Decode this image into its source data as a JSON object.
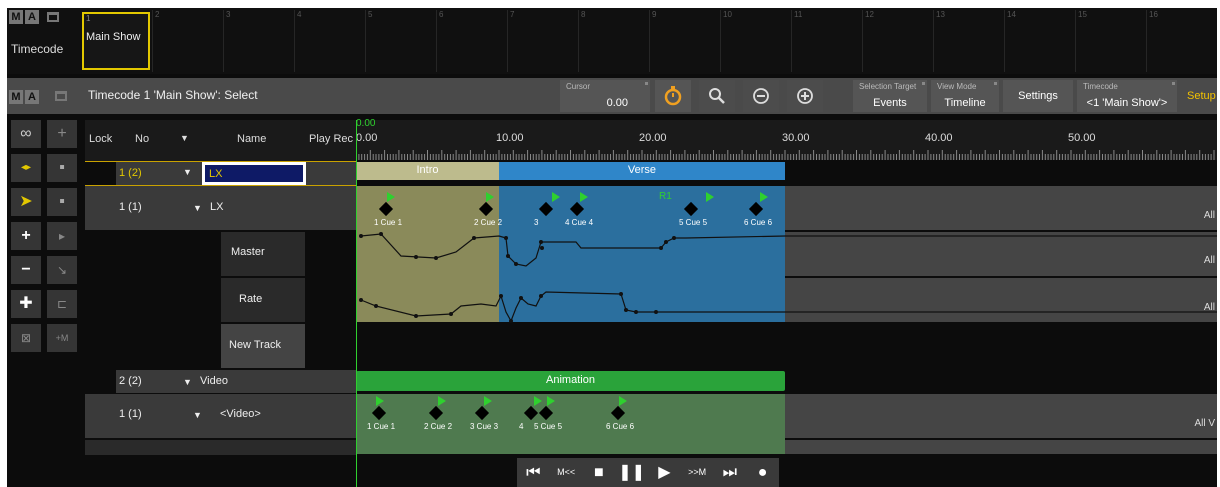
{
  "pool": {
    "logo": [
      "M",
      "A"
    ],
    "label": "Timecode",
    "selected_slot": {
      "number": "1",
      "label": "Main Show"
    },
    "slot_numbers": [
      "2",
      "3",
      "4",
      "5",
      "6",
      "7",
      "8",
      "9",
      "10",
      "11",
      "12",
      "13",
      "14",
      "15",
      "16"
    ]
  },
  "titlebar": {
    "logo": [
      "M",
      "A"
    ],
    "title": "Timecode 1 'Main Show': Select",
    "cursor": {
      "small": "Cursor",
      "value": "0.00"
    },
    "selection_target": {
      "small": "Selection Target",
      "value": "Events"
    },
    "view_mode": {
      "small": "View Mode",
      "value": "Timeline"
    },
    "settings": "Settings",
    "timecode": {
      "small": "Timecode",
      "value": "<1 'Main Show'>"
    },
    "setup": "Setup",
    "icons": [
      "stopwatch-icon",
      "search-icon",
      "zoom-out-icon",
      "zoom-in-icon"
    ]
  },
  "columns": {
    "lock": "Lock",
    "no": "No",
    "name": "Name",
    "play_rec": "Play Rec",
    "arrow": "▼"
  },
  "ruler": {
    "cursor_label": "0.00",
    "ticks": [
      "0.00",
      "10.00",
      "20.00",
      "30.00",
      "40.00",
      "50.00"
    ]
  },
  "tracks": [
    {
      "no": "1 (2)",
      "name": "LX",
      "kind": "group"
    },
    {
      "no": "1 (1)",
      "name": "LX",
      "kind": "track",
      "right_tag": "All"
    },
    {
      "name": "Master",
      "kind": "fader",
      "right_tag": "All"
    },
    {
      "name": "Rate",
      "kind": "fader",
      "right_tag": "All"
    },
    {
      "name": "New Track",
      "kind": "new"
    },
    {
      "no": "2 (2)",
      "name": "Video",
      "kind": "group"
    },
    {
      "no": "1 (1)",
      "name": "<Video>",
      "kind": "track",
      "right_tag": "All V"
    }
  ],
  "segments": {
    "intro": "Intro",
    "verse": "Verse",
    "animation": "Animation"
  },
  "lx_cues": [
    "1 Cue 1",
    "2 Cue 2",
    "3",
    "4 Cue 4",
    "5 Cue 5",
    "6 Cue 6"
  ],
  "lx_marker": "R1",
  "video_cues": [
    "1 Cue 1",
    "2 Cue 2",
    "3 Cue 3",
    "4",
    "5 Cue 5",
    "6 Cue 6"
  ],
  "transport": [
    "⏮",
    "M<<",
    "■",
    "❚❚",
    "▶",
    ">>M",
    "⏭",
    "●"
  ],
  "colors": {
    "accent_yellow": "#e3c800",
    "intro": "#8a8a5a",
    "verse": "#2e7fbf",
    "animation": "#2a9a3a",
    "cue_flag": "#2fd02f"
  }
}
